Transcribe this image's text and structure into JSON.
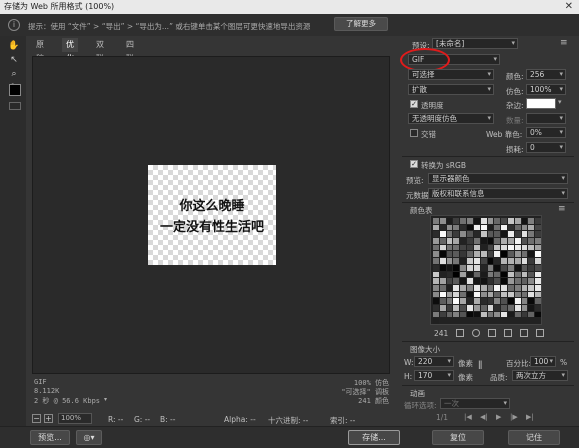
{
  "window": {
    "title": "存储为 Web 所用格式 (100%)"
  },
  "tip": {
    "text": "提示：使用 “文件” > “导出” > “导出为...” 或右键单击某个图层可更快速地导出资源",
    "learn_more": "了解更多"
  },
  "tabs": [
    "原稿",
    "优化",
    "双联",
    "四联"
  ],
  "preview": {
    "line1": "你这么晚睡",
    "line2": "一定没有性生活吧"
  },
  "status_left": {
    "format": "GIF",
    "size": "8.112K",
    "speed": "2 秒 @ 56.6 Kbps"
  },
  "status_right": {
    "quality": "100% 仿色",
    "palette": "\"可选择\" 调板",
    "colors": "241 颜色"
  },
  "bottom": {
    "zoom": "100%",
    "r": "R: --",
    "g": "G: --",
    "b": "B: --",
    "alpha": "Alpha: --",
    "hex": "十六进制: --",
    "index": "索引: --"
  },
  "footer": {
    "preview": "预览...",
    "save": "存储...",
    "reset": "复位",
    "remember": "记住"
  },
  "panel": {
    "preset_label": "预设:",
    "preset_value": "[未命名]",
    "format": "GIF",
    "reduction": "可选择",
    "colors_label": "颜色:",
    "colors_value": "256",
    "dither_algo": "扩散",
    "dither_label": "仿色:",
    "dither_value": "100%",
    "transparency_label": "透明度",
    "matte_label": "杂边:",
    "transparency_dither": "无透明度仿色",
    "amount_label": "数量:",
    "interlaced_label": "交错",
    "websnap_label": "Web 靠色:",
    "websnap_value": "0%",
    "lossy_label": "损耗:",
    "lossy_value": "0",
    "srgb_label": "转换为 sRGB",
    "preview_label": "预览:",
    "preview_value": "显示器颜色",
    "metadata_label": "元数据:",
    "metadata_value": "版权和联系信息",
    "color_table_label": "颜色表",
    "color_count": "241",
    "image_size_label": "图像大小",
    "w_label": "W:",
    "w_value": "220",
    "h_label": "H:",
    "h_value": "170",
    "px_unit": "像素",
    "percent_label": "百分比:",
    "percent_value": "100",
    "percent_unit": "%",
    "quality_label": "品质:",
    "quality_value": "两次立方",
    "animation_label": "动画",
    "loop_label": "循环选项:",
    "loop_value": "一次",
    "frame_counter": "1/1"
  },
  "colors": {
    "accent_red": "#e01b1b",
    "bg": "#353535"
  }
}
